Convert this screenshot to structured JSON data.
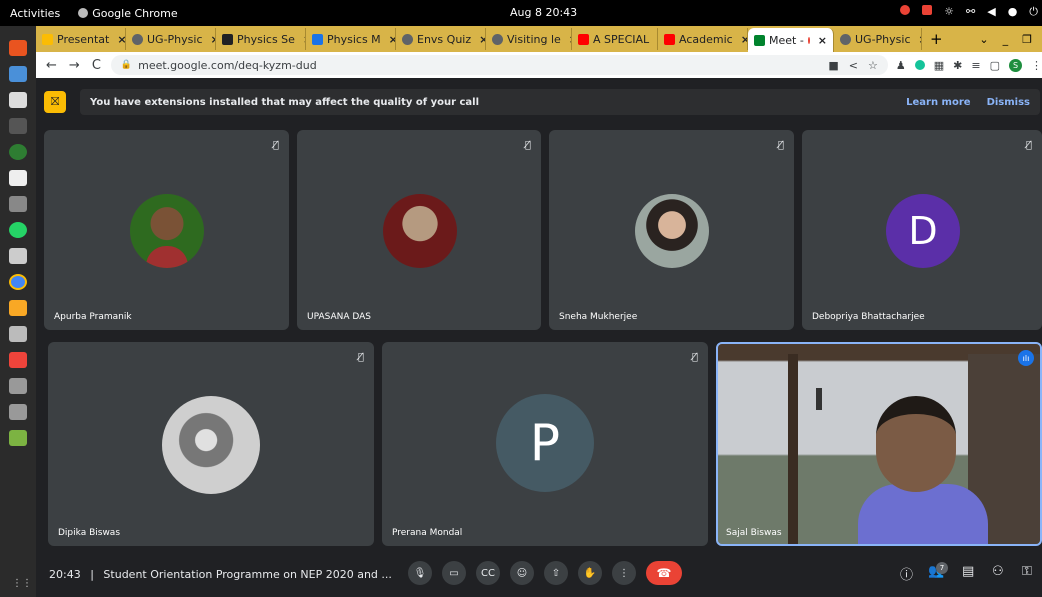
{
  "system": {
    "activities": "Activities",
    "app_name": "Google Chrome",
    "clock": "Aug 8  20:43"
  },
  "browser": {
    "tabs": [
      {
        "label": "Presentat",
        "favicon_color": "#fbbc04"
      },
      {
        "label": "UG-Physic",
        "favicon_color": "#5f6368"
      },
      {
        "label": "Physics Se",
        "favicon_color": "#202124"
      },
      {
        "label": "Physics M",
        "favicon_color": "#1a73e8"
      },
      {
        "label": "Envs Quiz",
        "favicon_color": "#5f6368"
      },
      {
        "label": "Visiting le",
        "favicon_color": "#5f6368"
      },
      {
        "label": "A SPECIAL",
        "favicon_color": "#ff0000"
      },
      {
        "label": "Academic",
        "favicon_color": "#ff0000"
      },
      {
        "label": "Meet -",
        "favicon_color": "#00832d",
        "active": true
      },
      {
        "label": "UG-Physic",
        "favicon_color": "#5f6368"
      }
    ],
    "new_tab": "+",
    "url": "meet.google.com/deq-kyzm-dud",
    "profile_initial": "S"
  },
  "meet": {
    "banner_text": "You have extensions installed that may affect the quality of your call",
    "learn_more": "Learn more",
    "dismiss": "Dismiss",
    "participants": [
      {
        "name": "Apurba Pramanik",
        "muted": true,
        "kind": "photo"
      },
      {
        "name": "UPASANA DAS",
        "muted": true,
        "kind": "photo"
      },
      {
        "name": "Sneha Mukherjee",
        "muted": true,
        "kind": "photo"
      },
      {
        "name": "Debopriya Bhattacharjee",
        "muted": true,
        "kind": "letter",
        "letter": "D",
        "color": "#5b2fa8"
      },
      {
        "name": "Dipika Biswas",
        "muted": true,
        "kind": "photo"
      },
      {
        "name": "Prerana Mondal",
        "muted": true,
        "kind": "letter",
        "letter": "P",
        "color": "#455a64"
      },
      {
        "name": "Sajal Biswas",
        "muted": false,
        "kind": "video",
        "speaking": true
      }
    ],
    "time": "20:43",
    "separator": "|",
    "meeting_title": "Student Orientation Programme on NEP 2020 and ...",
    "participant_count": "7",
    "accent": "#8ab4f8",
    "end_call_color": "#ea4335"
  }
}
